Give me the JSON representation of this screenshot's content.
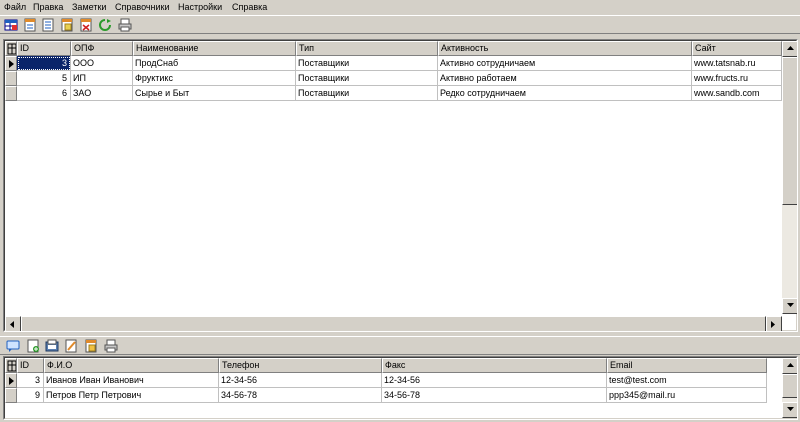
{
  "menu": [
    {
      "id": "file",
      "label": "Файл"
    },
    {
      "id": "edit",
      "label": "Правка"
    },
    {
      "id": "notes",
      "label": "Заметки"
    },
    {
      "id": "refs",
      "label": "Справочники"
    },
    {
      "id": "settings",
      "label": "Настройки"
    },
    {
      "id": "help",
      "label": "Справка"
    }
  ],
  "toolbar_top": {
    "icons": [
      "open-table-icon",
      "add-record-icon",
      "edit-record-icon",
      "delete-record-icon",
      "refresh-icon",
      "print-icon"
    ]
  },
  "companies": {
    "columns": [
      "ID",
      "ОПФ",
      "Наименование",
      "Тип",
      "Активность",
      "Сайт"
    ],
    "rows": [
      {
        "id": "3",
        "opf": "ООО",
        "name": "ПродСнаб",
        "type": "Поставщики",
        "activity": "Активно сотрудничаем",
        "site": "www.tatsnab.ru"
      },
      {
        "id": "5",
        "opf": "ИП",
        "name": "Фруктикс",
        "type": "Поставщики",
        "activity": "Активно работаем",
        "site": "www.fructs.ru"
      },
      {
        "id": "6",
        "opf": "ЗАО",
        "name": "Сырье и Быт",
        "type": "Поставщики",
        "activity": "Редко сотрудничаем",
        "site": "www.sandb.com"
      }
    ]
  },
  "toolbar_bottom": {
    "icons": [
      "comment-icon",
      "add-contact-icon",
      "contacts-icon",
      "edit-contact-icon",
      "delete-contact-icon",
      "print-icon"
    ]
  },
  "contacts": {
    "columns": [
      "ID",
      "Ф.И.О",
      "Телефон",
      "Факс",
      "Email"
    ],
    "rows": [
      {
        "id": "3",
        "fio": "Иванов Иван Иванович",
        "phone": "12-34-56",
        "fax": "12-34-56",
        "email": "test@test.com"
      },
      {
        "id": "9",
        "fio": "Петров Петр Петрович",
        "phone": "34-56-78",
        "fax": "34-56-78",
        "email": "ppp345@mail.ru"
      }
    ]
  },
  "colors": {
    "face": "#d4d0c8",
    "selection": "#0a246a",
    "grid_line": "#c0c0c0"
  }
}
